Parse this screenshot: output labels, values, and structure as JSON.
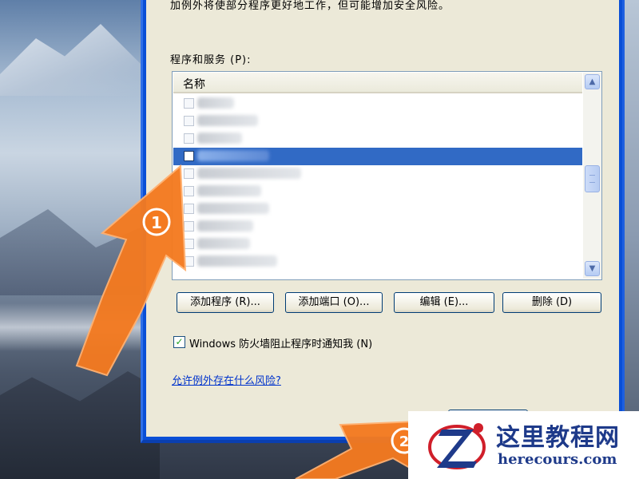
{
  "dialog": {
    "description": "加例外将使部分程序更好地工作，但可能增加安全风险。",
    "programs_label": "程序和服务 (P):",
    "list_header": "名称",
    "rows": [
      {
        "checked": false,
        "selected": false
      },
      {
        "checked": false,
        "selected": false
      },
      {
        "checked": false,
        "selected": false
      },
      {
        "checked": false,
        "selected": true
      },
      {
        "checked": false,
        "selected": false
      },
      {
        "checked": false,
        "selected": false
      },
      {
        "checked": false,
        "selected": false
      },
      {
        "checked": false,
        "selected": false
      },
      {
        "checked": false,
        "selected": false
      },
      {
        "checked": false,
        "selected": false
      }
    ],
    "buttons": {
      "add_program": "添加程序 (R)...",
      "add_port": "添加端口 (O)...",
      "edit": "编辑 (E)...",
      "delete": "删除 (D)"
    },
    "notify_checkbox": {
      "label": "Windows 防火墙阻止程序时通知我 (N)",
      "checked": true
    },
    "risk_link": "允许例外存在什么风险?"
  },
  "annotations": {
    "step1": "1",
    "step2": "2",
    "arrow_color": "#f47a20"
  },
  "logo": {
    "title": "这里教程网",
    "url": "herecours.com"
  },
  "colors": {
    "selection": "#316ac5",
    "xp_title_blue": "#0a4fd6",
    "dialog_face": "#ece9d8",
    "logo_blue": "#1e3a8a",
    "logo_red": "#d01f2a"
  }
}
